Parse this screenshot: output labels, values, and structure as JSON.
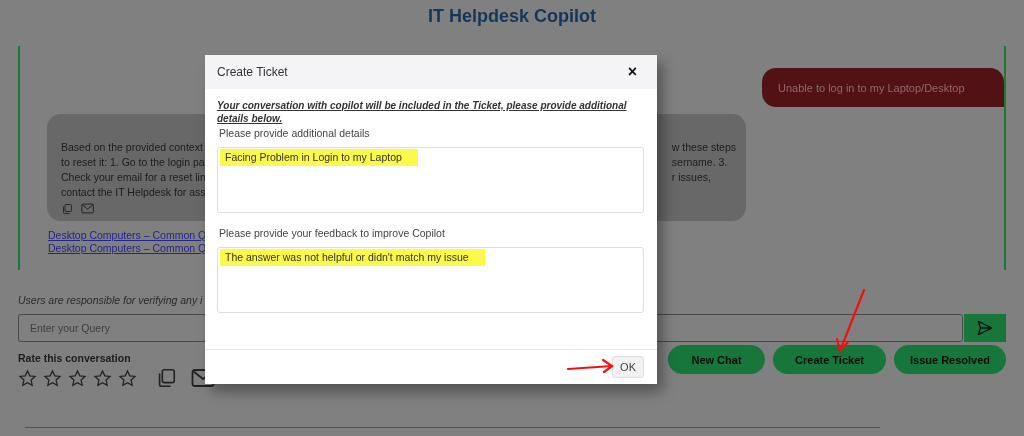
{
  "header": {
    "title": "IT Helpdesk Copilot"
  },
  "chat": {
    "messages": [
      {
        "kind": "user",
        "text": "Unable to log in to my Laptop/Desktop"
      },
      {
        "kind": "bot",
        "text_left": [
          "Based on the provided context",
          "to reset it: 1. Go to the login pa",
          "Check your email for a reset lin",
          "contact the IT Helpdesk for ass"
        ],
        "text_right": [
          "w these steps",
          "sername. 3.",
          "r issues,"
        ]
      }
    ],
    "sources": [
      "Desktop Computers – Common Q",
      "Desktop Computers – Common Q"
    ]
  },
  "disclaimer": "Users are responsible for verifying any i",
  "query": {
    "placeholder": "Enter your Query"
  },
  "rating": {
    "label": "Rate this conversation",
    "stars": 0
  },
  "actions": [
    "New Chat",
    "Create Ticket",
    "Issue Resolved"
  ],
  "dialog": {
    "title": "Create Ticket",
    "close": "×",
    "note": "Your conversation with copilot will be included in the Ticket, please provide additional details below.",
    "fields": [
      {
        "label": "Please provide additional details",
        "value": "Facing Problem in Login to my Laptop",
        "highlighted": true
      },
      {
        "label": "Please provide your feedback to improve Copilot",
        "value": "The answer was not helpful or didn't match my issue",
        "highlighted": true
      }
    ],
    "buttons": [
      "OK"
    ]
  }
}
